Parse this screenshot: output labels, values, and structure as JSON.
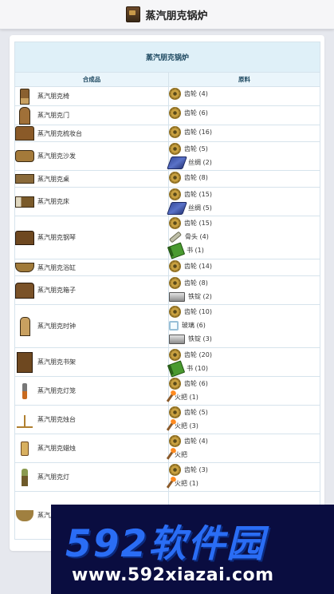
{
  "header": {
    "title": "蒸汽朋克锅炉",
    "icon": "steampunk-boiler-icon"
  },
  "table": {
    "title": "蒸汽朋克锅炉",
    "col_result": "合成品",
    "col_materials": "原料",
    "rows": [
      {
        "name": "蒸汽朋克椅",
        "icon": "sp-chair",
        "ings": [
          {
            "label": "齿轮 (4)",
            "icon": "gear"
          }
        ]
      },
      {
        "name": "蒸汽朋克门",
        "icon": "sp-door",
        "ings": [
          {
            "label": "齿轮 (6)",
            "icon": "gear"
          }
        ]
      },
      {
        "name": "蒸汽朋克梳妆台",
        "icon": "sp-dresser",
        "ings": [
          {
            "label": "齿轮 (16)",
            "icon": "gear"
          }
        ]
      },
      {
        "name": "蒸汽朋克沙发",
        "icon": "sp-sofa",
        "ings": [
          {
            "label": "齿轮 (5)",
            "icon": "gear"
          },
          {
            "label": "丝绸 (2)",
            "icon": "silk"
          }
        ]
      },
      {
        "name": "蒸汽朋克桌",
        "icon": "sp-table",
        "ings": [
          {
            "label": "齿轮 (8)",
            "icon": "gear"
          }
        ]
      },
      {
        "name": "蒸汽朋克床",
        "icon": "sp-bed",
        "ings": [
          {
            "label": "齿轮 (15)",
            "icon": "gear"
          },
          {
            "label": "丝绸 (5)",
            "icon": "silk"
          }
        ]
      },
      {
        "name": "蒸汽朋克钢琴",
        "icon": "sp-piano",
        "ings": [
          {
            "label": "齿轮 (15)",
            "icon": "gear"
          },
          {
            "label": "骨头 (4)",
            "icon": "bone"
          },
          {
            "label": "书 (1)",
            "icon": "book"
          }
        ]
      },
      {
        "name": "蒸汽朋克浴缸",
        "icon": "sp-bath",
        "ings": [
          {
            "label": "齿轮 (14)",
            "icon": "gear"
          }
        ]
      },
      {
        "name": "蒸汽朋克箱子",
        "icon": "sp-chest",
        "ings": [
          {
            "label": "齿轮 (8)",
            "icon": "gear"
          },
          {
            "label": "铁锭 (2)",
            "icon": "iron"
          }
        ]
      },
      {
        "name": "蒸汽朋克时钟",
        "icon": "sp-clock",
        "ings": [
          {
            "label": "齿轮 (10)",
            "icon": "gear"
          },
          {
            "label": "玻璃 (6)",
            "icon": "glass"
          },
          {
            "label": "铁锭 (3)",
            "icon": "iron"
          }
        ]
      },
      {
        "name": "蒸汽朋克书架",
        "icon": "sp-shelf",
        "ings": [
          {
            "label": "齿轮 (20)",
            "icon": "gear"
          },
          {
            "label": "书 (10)",
            "icon": "book"
          }
        ]
      },
      {
        "name": "蒸汽朋克灯笼",
        "icon": "sp-lantern",
        "ings": [
          {
            "label": "齿轮 (6)",
            "icon": "gear"
          },
          {
            "label": "火把 (1)",
            "icon": "torch"
          }
        ]
      },
      {
        "name": "蒸汽朋克烛台",
        "icon": "sp-candela",
        "ings": [
          {
            "label": "齿轮 (5)",
            "icon": "gear"
          },
          {
            "label": "火把 (3)",
            "icon": "torch"
          }
        ]
      },
      {
        "name": "蒸汽朋克蜡烛",
        "icon": "sp-candle",
        "ings": [
          {
            "label": "齿轮 (4)",
            "icon": "gear"
          },
          {
            "label": "火把",
            "icon": "torch"
          }
        ]
      },
      {
        "name": "蒸汽朋克灯",
        "icon": "sp-lamp",
        "ings": [
          {
            "label": "齿轮 (3)",
            "icon": "gear"
          },
          {
            "label": "火把 (1)",
            "icon": "torch"
          }
        ]
      },
      {
        "name": "蒸汽朋",
        "icon": "sp-chand",
        "ings": []
      }
    ]
  },
  "watermark": {
    "logo": "592软件园",
    "url": "www.592xiazai.com"
  }
}
